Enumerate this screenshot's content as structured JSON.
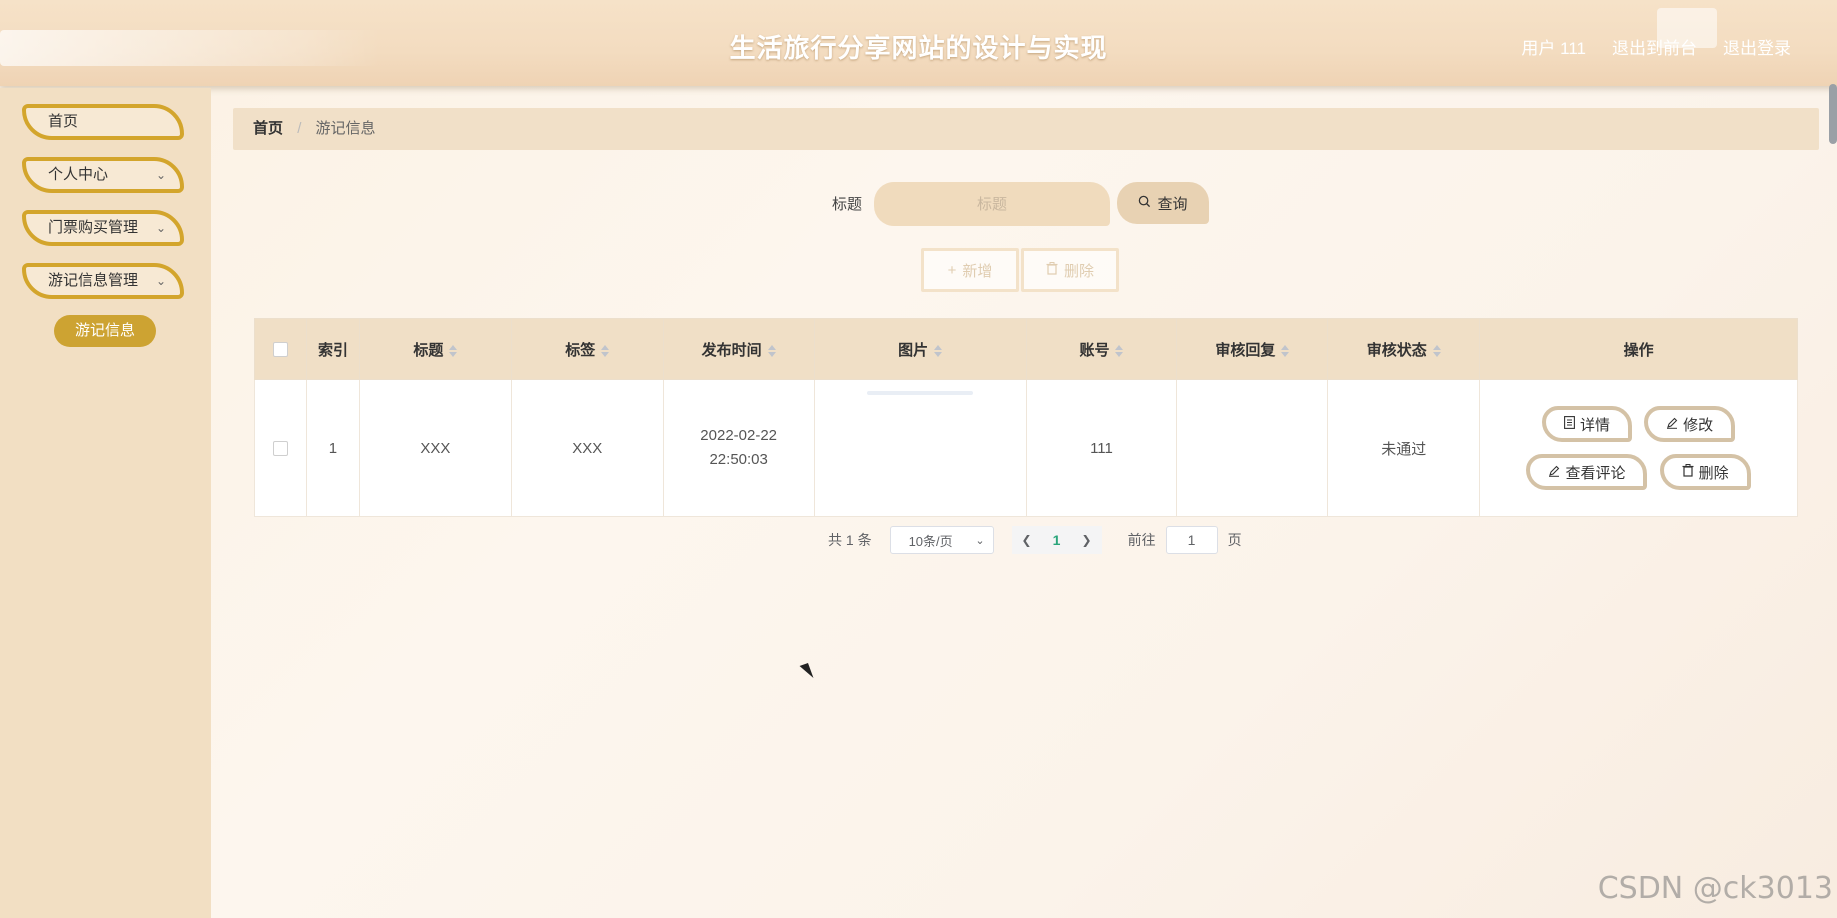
{
  "header": {
    "title": "生活旅行分享网站的设计与实现",
    "user_label": "用户 111",
    "back_front_label": "退出到前台",
    "logout_label": "退出登录"
  },
  "sidebar": {
    "items": [
      {
        "label": "首页",
        "has_submenu": false
      },
      {
        "label": "个人中心",
        "has_submenu": true
      },
      {
        "label": "门票购买管理",
        "has_submenu": true
      },
      {
        "label": "游记信息管理",
        "has_submenu": true
      }
    ],
    "active_sub_item": "游记信息"
  },
  "breadcrumb": {
    "home": "首页",
    "separator": "/",
    "current": "游记信息"
  },
  "search": {
    "label": "标题",
    "placeholder": "标题",
    "value": "",
    "button_label": "查询"
  },
  "toolbar": {
    "add_label": "新增",
    "delete_label": "删除"
  },
  "table": {
    "headers": [
      "索引",
      "标题",
      "标签",
      "发布时间",
      "图片",
      "账号",
      "审核回复",
      "审核状态",
      "操作"
    ],
    "rows": [
      {
        "index": "1",
        "title": "XXX",
        "tag": "XXX",
        "publish_time": "2022-02-22 22:50:03",
        "image": "",
        "account": "111",
        "review_reply": "",
        "review_status": "未通过",
        "actions": {
          "detail": "详情",
          "edit": "修改",
          "comments": "查看评论",
          "delete": "删除"
        }
      }
    ]
  },
  "pagination": {
    "total_text": "共 1 条",
    "page_size": "10条/页",
    "current_page": "1",
    "goto_prefix": "前往",
    "goto_value": "1",
    "goto_suffix": "页"
  },
  "watermark": "CSDN @ck3013",
  "colors": {
    "accent_gold": "#cda332",
    "header_bg": "#f3dcc0",
    "sidebar_bg": "#f2dfc3",
    "table_header_bg": "#f0dfc6",
    "active_page": "#2aa57b"
  }
}
